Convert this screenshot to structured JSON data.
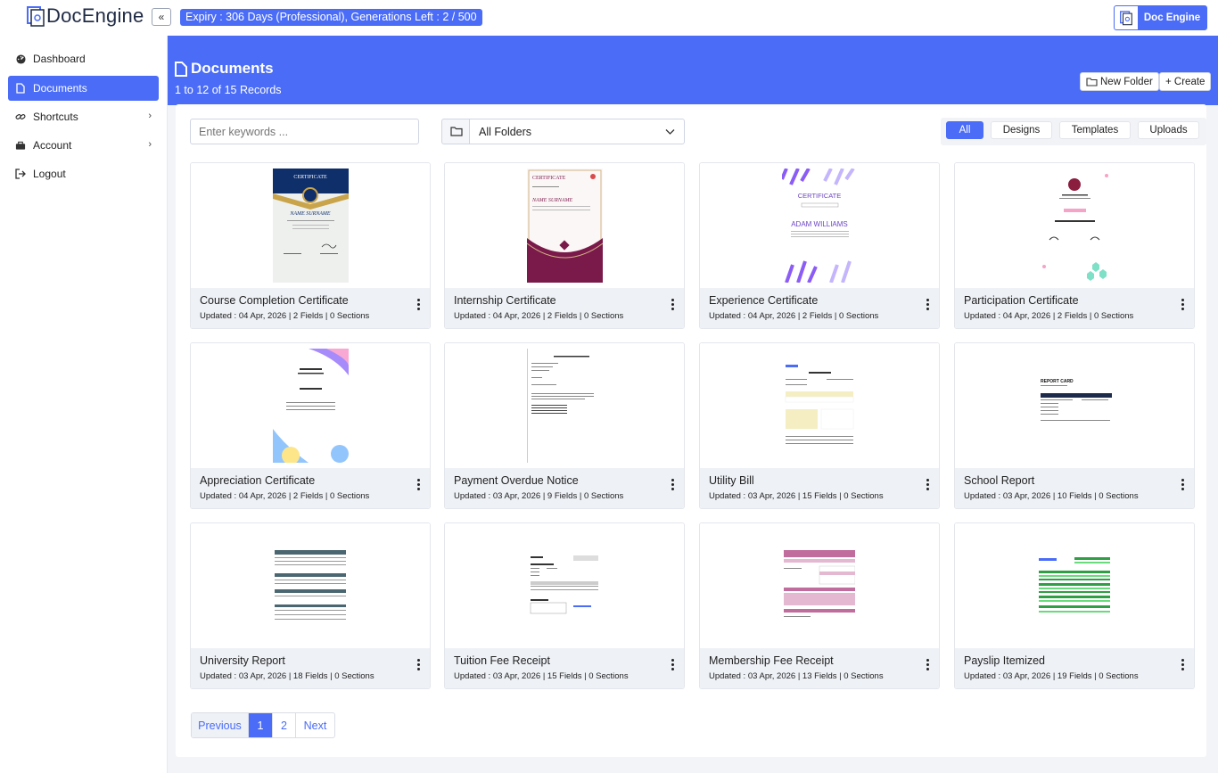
{
  "app": {
    "name": "DocEngine",
    "expiry_badge": "Expiry : 306 Days (Professional), Generations Left : 2 / 500",
    "user_button": "Doc Engine",
    "collapse_icon": "double-chevron-left-icon"
  },
  "sidebar": {
    "items": [
      {
        "label": "Dashboard",
        "icon": "dashboard-icon",
        "active": false,
        "has_submenu": false
      },
      {
        "label": "Documents",
        "icon": "document-icon",
        "active": true,
        "has_submenu": false
      },
      {
        "label": "Shortcuts",
        "icon": "link-icon",
        "active": false,
        "has_submenu": true
      },
      {
        "label": "Account",
        "icon": "account-icon",
        "active": false,
        "has_submenu": true
      },
      {
        "label": "Logout",
        "icon": "logout-icon",
        "active": false,
        "has_submenu": false
      }
    ]
  },
  "header": {
    "title": "Documents",
    "records": "1 to 12 of 15 Records",
    "new_folder": "New Folder",
    "create": "+ Create"
  },
  "toolbar": {
    "search_placeholder": "Enter keywords ...",
    "folder_selected": "All Folders",
    "filters": [
      "All",
      "Designs",
      "Templates",
      "Uploads"
    ],
    "active_filter": "All"
  },
  "documents": [
    {
      "title": "Course Completion Certificate",
      "meta": "Updated : 04 Apr, 2026 | 2 Fields | 0 Sections",
      "thumb": "cert-blue-gold"
    },
    {
      "title": "Internship Certificate",
      "meta": "Updated : 04 Apr, 2026 | 2 Fields | 0 Sections",
      "thumb": "cert-maroon"
    },
    {
      "title": "Experience Certificate",
      "meta": "Updated : 04 Apr, 2026 | 2 Fields | 0 Sections",
      "thumb": "cert-purple-stripes"
    },
    {
      "title": "Participation Certificate",
      "meta": "Updated : 04 Apr, 2026 | 2 Fields | 0 Sections",
      "thumb": "cert-pink-hex"
    },
    {
      "title": "Appreciation Certificate",
      "meta": "Updated : 04 Apr, 2026 | 2 Fields | 0 Sections",
      "thumb": "cert-pastel"
    },
    {
      "title": "Payment Overdue Notice",
      "meta": "Updated : 03 Apr, 2026 | 9 Fields | 0 Sections",
      "thumb": "letter-plain"
    },
    {
      "title": "Utility Bill",
      "meta": "Updated : 03 Apr, 2026 | 15 Fields | 0 Sections",
      "thumb": "bill-yellow"
    },
    {
      "title": "School Report",
      "meta": "Updated : 03 Apr, 2026 | 10 Fields | 0 Sections",
      "thumb": "report-navy"
    },
    {
      "title": "University Report",
      "meta": "Updated : 03 Apr, 2026 | 18 Fields | 0 Sections",
      "thumb": "report-teal"
    },
    {
      "title": "Tuition Fee Receipt",
      "meta": "Updated : 03 Apr, 2026 | 15 Fields | 0 Sections",
      "thumb": "receipt-gray"
    },
    {
      "title": "Membership Fee Receipt",
      "meta": "Updated : 03 Apr, 2026 | 13 Fields | 0 Sections",
      "thumb": "receipt-pink"
    },
    {
      "title": "Payslip Itemized",
      "meta": "Updated : 03 Apr, 2026 | 19 Fields | 0 Sections",
      "thumb": "payslip-green"
    }
  ],
  "thumb_text": {
    "course_cert_title": "CERTIFICATE",
    "course_cert_name": "NAME SURNAME",
    "intern_cert_title": "CERTIFICATE",
    "intern_cert_name": "NAME SURNAME",
    "exp_cert_title": "CERTIFICATE",
    "exp_cert_name": "ADAM WILLIAMS",
    "school_report_title": "REPORT CARD"
  },
  "pagination": {
    "previous": "Previous",
    "pages": [
      "1",
      "2"
    ],
    "current": "1",
    "next": "Next"
  },
  "colors": {
    "accent": "#4a6cf7",
    "background": "#f3f4f8",
    "card_footer": "#eef1f6"
  }
}
